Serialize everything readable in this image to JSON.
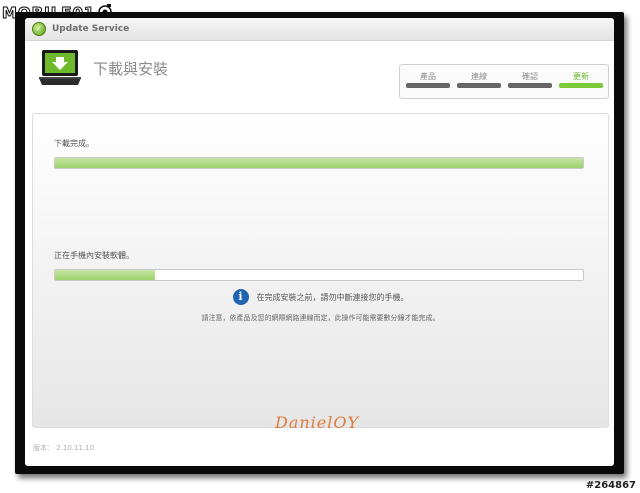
{
  "site_logo": {
    "text": "MOBILE01"
  },
  "window": {
    "app_title": "Update Service",
    "page_title": "下載與安裝",
    "steps": [
      {
        "label": "產品",
        "active": false
      },
      {
        "label": "連線",
        "active": false
      },
      {
        "label": "確認",
        "active": false
      },
      {
        "label": "更新",
        "active": true
      }
    ]
  },
  "content": {
    "download_status": "下載完成。",
    "download_progress": 1.0,
    "install_status": "正在手機內安裝軟體。",
    "install_progress": 0.19,
    "info_message": "在完成安裝之前，請勿中斷連接您的手機。",
    "note": "請注意，依產品及您的網際網路連線而定，此操作可能需要數分鐘才能完成。"
  },
  "signature": "DanielOY",
  "version": "版本： 2.10.11.10",
  "watermark": "#264867",
  "colors": {
    "accent_green": "#7cc93a",
    "progress_fill": "#9ccf6c",
    "info_blue": "#1f64b0"
  }
}
